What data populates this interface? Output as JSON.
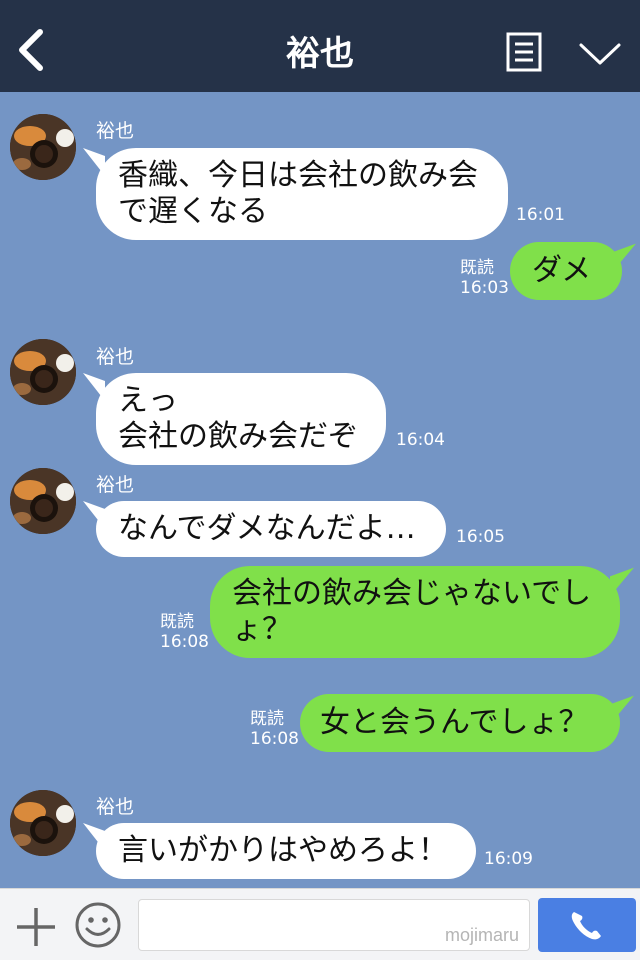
{
  "header": {
    "title": "裕也",
    "back_icon": "chevron-left-icon",
    "menu_icon": "menu-icon",
    "collapse_icon": "chevron-down-icon"
  },
  "messages": [
    {
      "side": "left",
      "sender": "裕也",
      "text_lines": [
        "香織、今日は会社の飲み会",
        "で遅くなる"
      ],
      "time": "16:01"
    },
    {
      "side": "right",
      "read": "既読",
      "text_lines": [
        "ダメ"
      ],
      "time": "16:03"
    },
    {
      "side": "left",
      "sender": "裕也",
      "text_lines": [
        "えっ",
        "会社の飲み会だぞ"
      ],
      "time": "16:04"
    },
    {
      "side": "left",
      "sender": "裕也",
      "text_lines": [
        "なんでダメなんだよ…"
      ],
      "time": "16:05"
    },
    {
      "side": "right",
      "read": "既読",
      "text_lines": [
        "会社の飲み会じゃないでし",
        "ょ？"
      ],
      "time": "16:08"
    },
    {
      "side": "right",
      "read": "既読",
      "text_lines": [
        "女と会うんでしょ？"
      ],
      "time": "16:08"
    },
    {
      "side": "left",
      "sender": "裕也",
      "text_lines": [
        "言いがかりはやめろよ！"
      ],
      "time": "16:09"
    }
  ],
  "footer": {
    "plus_icon": "plus-icon",
    "emoji_icon": "smile-icon",
    "input_value": "",
    "watermark": "mojimaru",
    "call_icon": "phone-icon"
  },
  "colors": {
    "header_bg": "#253248",
    "chat_bg": "#7495c5",
    "sent_bubble": "#80e04a",
    "received_bubble": "#ffffff",
    "call_button": "#4a7fe3"
  }
}
